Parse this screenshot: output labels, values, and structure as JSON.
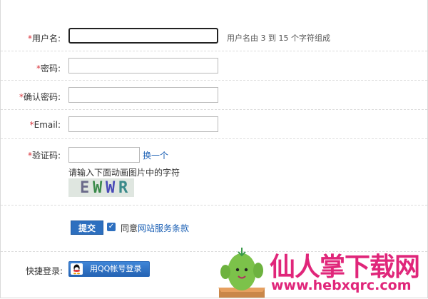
{
  "form": {
    "username": {
      "required_mark": "*",
      "label": "用户名:",
      "value": "",
      "hint": "用户名由 3 到 15 个字符组成"
    },
    "password": {
      "required_mark": "*",
      "label": "密码:",
      "value": ""
    },
    "confirm_password": {
      "required_mark": "*",
      "label": "确认密码:",
      "value": ""
    },
    "email": {
      "required_mark": "*",
      "label": "Email:",
      "value": ""
    },
    "captcha": {
      "required_mark": "*",
      "label": "验证码:",
      "value": "",
      "refresh_link": "换一个",
      "instruction": "请输入下面动画图片中的字符",
      "image_chars": [
        "E",
        "W",
        "W",
        "R"
      ]
    },
    "submit_label": "提交",
    "agree_checked": true,
    "agree_prefix": "同意",
    "agree_link": "网站服务条款"
  },
  "quick_login": {
    "label": "快捷登录:",
    "qq_button": "用QQ帐号登录"
  },
  "watermark": {
    "title": "仙人掌下载网",
    "url": "www.hebxqrc.com"
  },
  "colors": {
    "required": "#d9363e",
    "link": "#1a5fb4",
    "button": "#2d6fbf",
    "watermark": "#e0267a"
  }
}
